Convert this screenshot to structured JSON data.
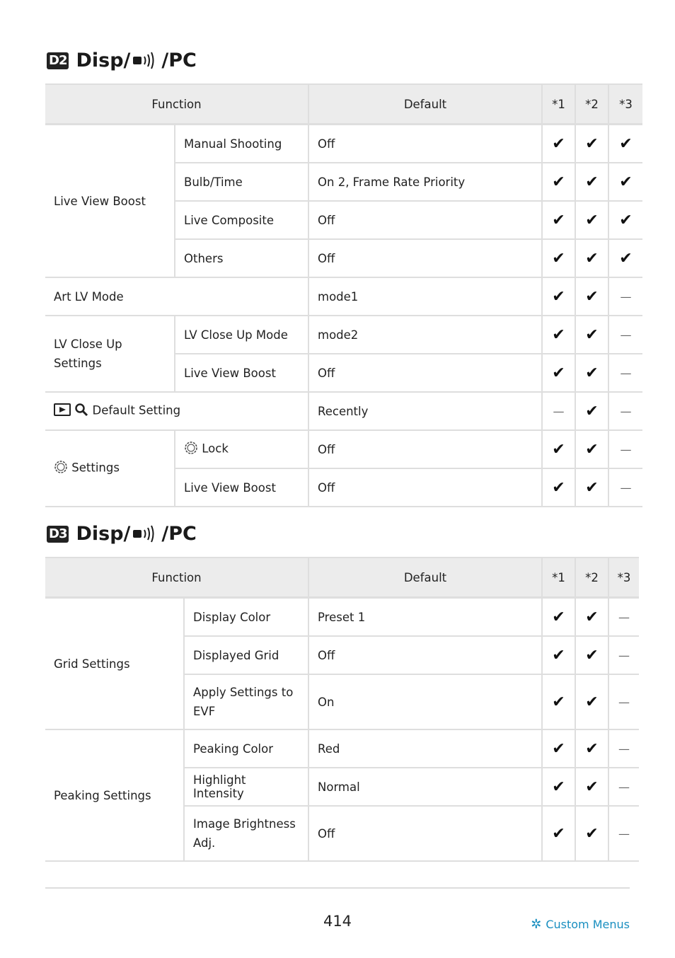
{
  "sections": [
    {
      "badge": "D2",
      "title_prefix": "Disp/",
      "title_suffix": "/PC",
      "headers": {
        "function": "Function",
        "default": "Default",
        "c1": "*1",
        "c2": "*2",
        "c3": "*3"
      },
      "rows": [
        {
          "group": "Live View Boost",
          "item": "Manual Shooting",
          "default": "Off",
          "c1": "✔",
          "c2": "✔",
          "c3": "✔"
        },
        {
          "group": "",
          "item": "Bulb/Time",
          "default": "On 2, Frame Rate Priority",
          "c1": "✔",
          "c2": "✔",
          "c3": "✔"
        },
        {
          "group": "",
          "item": "Live Composite",
          "default": "Off",
          "c1": "✔",
          "c2": "✔",
          "c3": "✔"
        },
        {
          "group": "",
          "item": "Others",
          "default": "Off",
          "c1": "✔",
          "c2": "✔",
          "c3": "✔"
        },
        {
          "group": "Art LV Mode",
          "item": "",
          "default": "mode1",
          "c1": "✔",
          "c2": "✔",
          "c3": "—"
        },
        {
          "group": "LV Close Up Settings",
          "item": "LV Close Up Mode",
          "default": "mode2",
          "c1": "✔",
          "c2": "✔",
          "c3": "—"
        },
        {
          "group": "",
          "item": "Live View Boost",
          "default": "Off",
          "c1": "✔",
          "c2": "✔",
          "c3": "—"
        },
        {
          "group": "Default Setting",
          "item": "",
          "default": "Recently",
          "c1": "—",
          "c2": "✔",
          "c3": "—"
        },
        {
          "group": "Settings",
          "item": "Lock",
          "default": "Off",
          "c1": "✔",
          "c2": "✔",
          "c3": "—"
        },
        {
          "group": "",
          "item": "Live View Boost",
          "default": "Off",
          "c1": "✔",
          "c2": "✔",
          "c3": "—"
        }
      ]
    },
    {
      "badge": "D3",
      "title_prefix": "Disp/",
      "title_suffix": "/PC",
      "headers": {
        "function": "Function",
        "default": "Default",
        "c1": "*1",
        "c2": "*2",
        "c3": "*3"
      },
      "rows": [
        {
          "group": "Grid Settings",
          "item": "Display Color",
          "default": "Preset 1",
          "c1": "✔",
          "c2": "✔",
          "c3": "—"
        },
        {
          "group": "",
          "item": "Displayed Grid",
          "default": "Off",
          "c1": "✔",
          "c2": "✔",
          "c3": "—"
        },
        {
          "group": "",
          "item": "Apply Settings to EVF",
          "default": "On",
          "c1": "✔",
          "c2": "✔",
          "c3": "—"
        },
        {
          "group": "Peaking Settings",
          "item": "Peaking Color",
          "default": "Red",
          "c1": "✔",
          "c2": "✔",
          "c3": "—"
        },
        {
          "group": "",
          "item": "Highlight Intensity",
          "default": "Normal",
          "c1": "✔",
          "c2": "✔",
          "c3": "—"
        },
        {
          "group": "",
          "item": "Image Brightness Adj.",
          "default": "Off",
          "c1": "✔",
          "c2": "✔",
          "c3": "—"
        }
      ]
    }
  ],
  "footer": {
    "page_number": "414",
    "link_label": "Custom Menus"
  }
}
